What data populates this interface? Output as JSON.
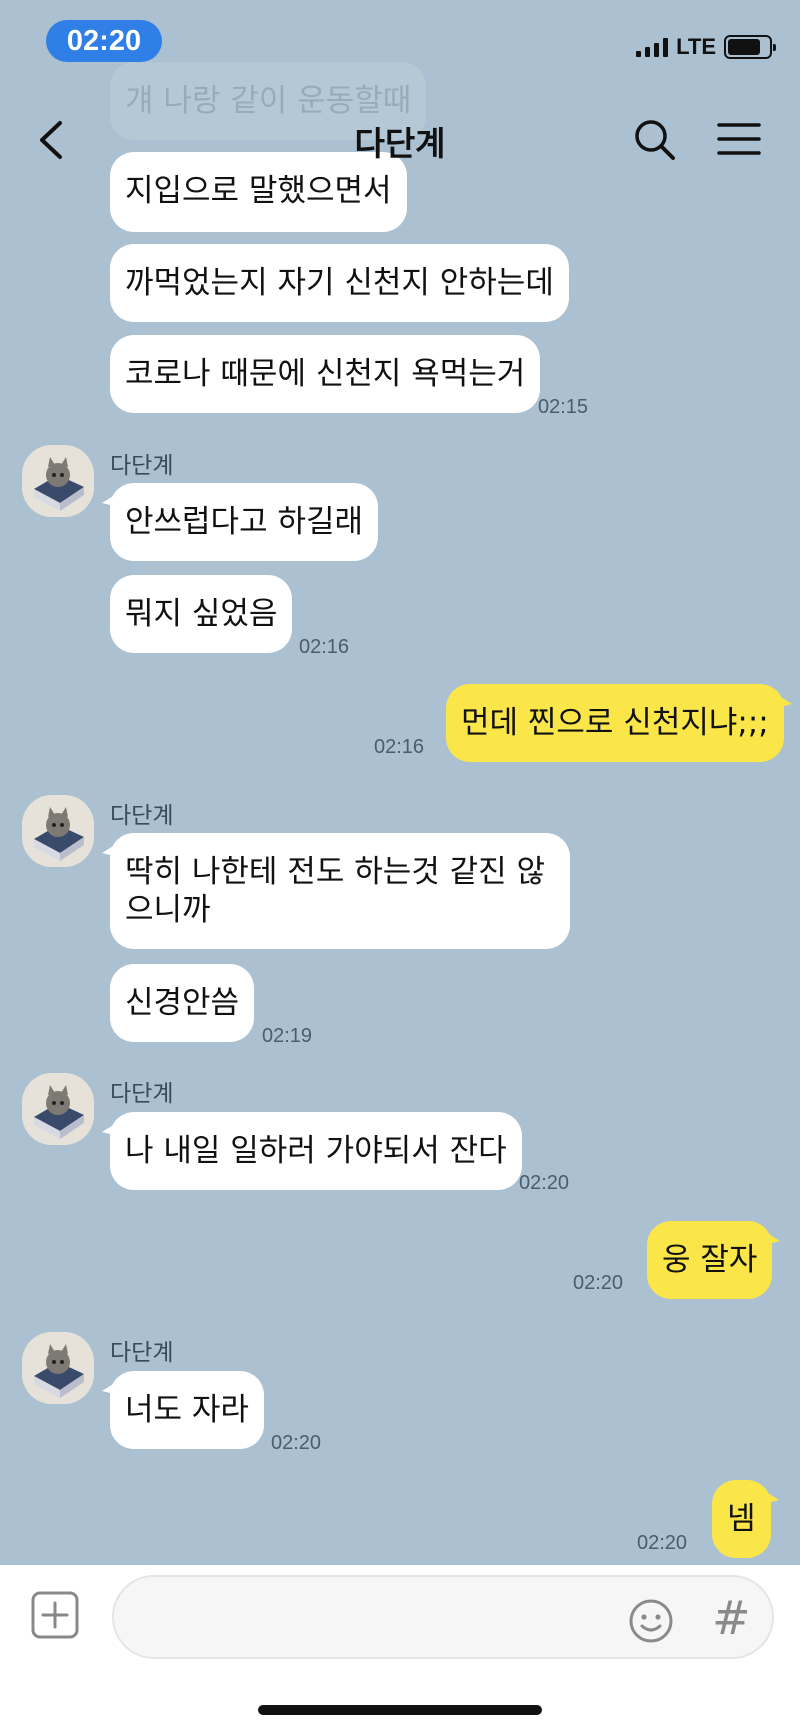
{
  "status_bar": {
    "time": "02:20",
    "network": "LTE",
    "battery_percent": 80
  },
  "header": {
    "title": "다단계",
    "back_icon": "chevron-left-icon",
    "search_icon": "search-icon",
    "menu_icon": "hamburger-menu-icon"
  },
  "messages": {
    "faded_top": "걔 나랑 같이 운동할때",
    "m1": "지입으로 말했으면서",
    "m2": "까먹었는지 자기 신천지 안하는데",
    "m3": "코로나 때문에 신천지 욕먹는거",
    "t3": "02:15",
    "sender1": "다단계",
    "m4": "안쓰럽다고 하길래",
    "m5": "뭐지 싶었음",
    "t5": "02:16",
    "m6": "먼데 찐으로 신천지냐;;;",
    "t6": "02:16",
    "sender2": "다단계",
    "m7": "딱히 나한테 전도 하는것 같진 않으니까",
    "m8": "신경안씀",
    "t8": "02:19",
    "sender3": "다단계",
    "m9": "나 내일 일하러 가야되서 잔다",
    "t9": "02:20",
    "m10": "웅 잘자",
    "t10": "02:20",
    "sender4": "다단계",
    "m11": "너도 자라",
    "t11": "02:20",
    "m12": "넴",
    "t12": "02:20"
  },
  "input_bar": {
    "plus_icon": "plus-square-icon",
    "placeholder": "",
    "emoji_icon": "emoji-icon",
    "hash_label": "#"
  },
  "colors": {
    "background": "#abc1d1",
    "my_bubble": "#fbe64a",
    "their_bubble": "#ffffff",
    "time_pill": "#2f7fe6"
  }
}
